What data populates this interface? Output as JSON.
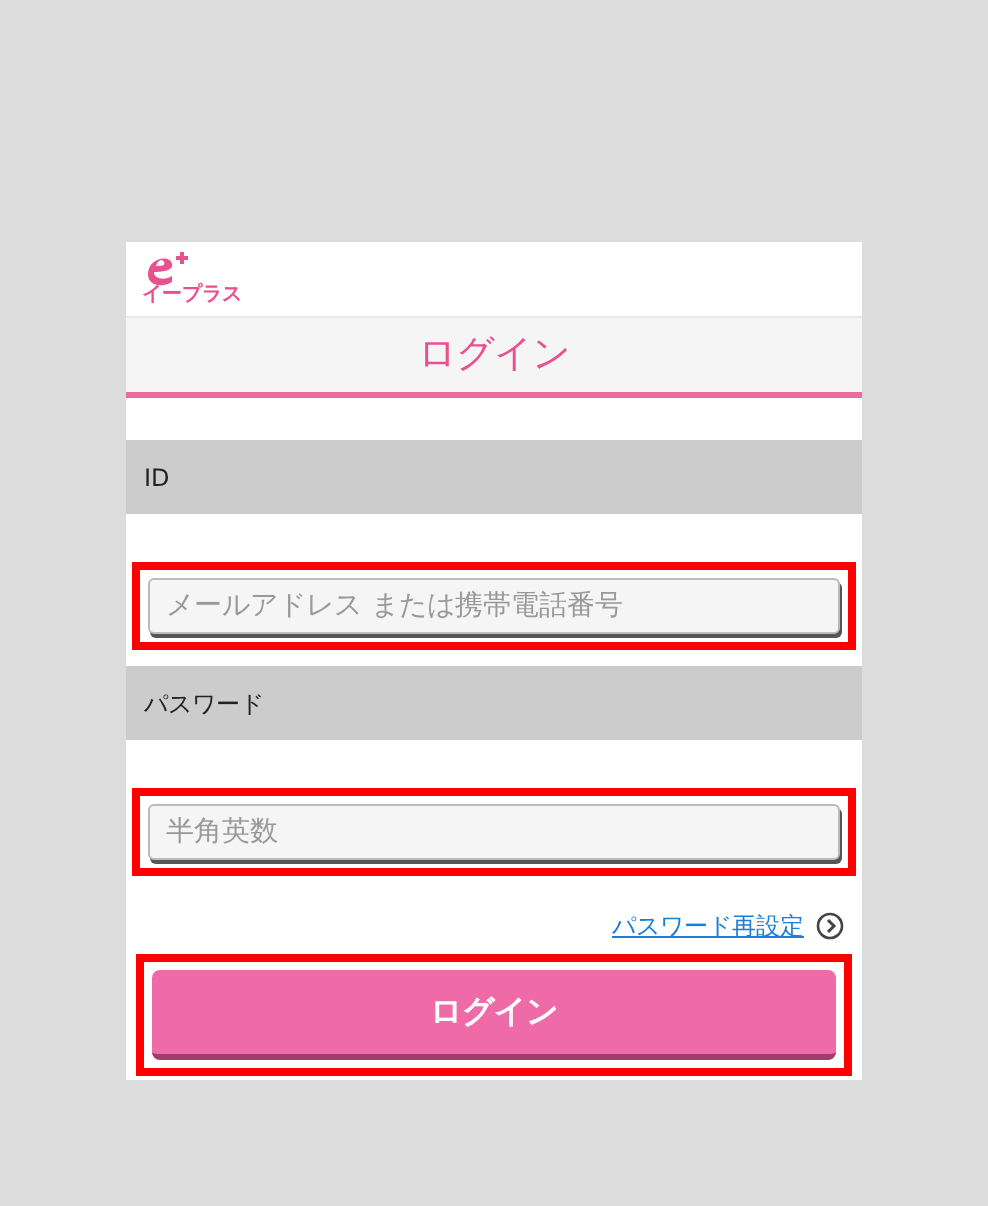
{
  "header": {
    "logo_text": "イープラス"
  },
  "title": "ログイン",
  "fields": [
    {
      "label": "ID",
      "placeholder": "メールアドレス または携帯電話番号",
      "highlighted": true
    },
    {
      "label": "パスワード",
      "placeholder": "半角英数",
      "highlighted": true
    }
  ],
  "reset_link": {
    "label": "パスワード再設定"
  },
  "login_button": {
    "label": "ログイン",
    "highlighted": true
  }
}
